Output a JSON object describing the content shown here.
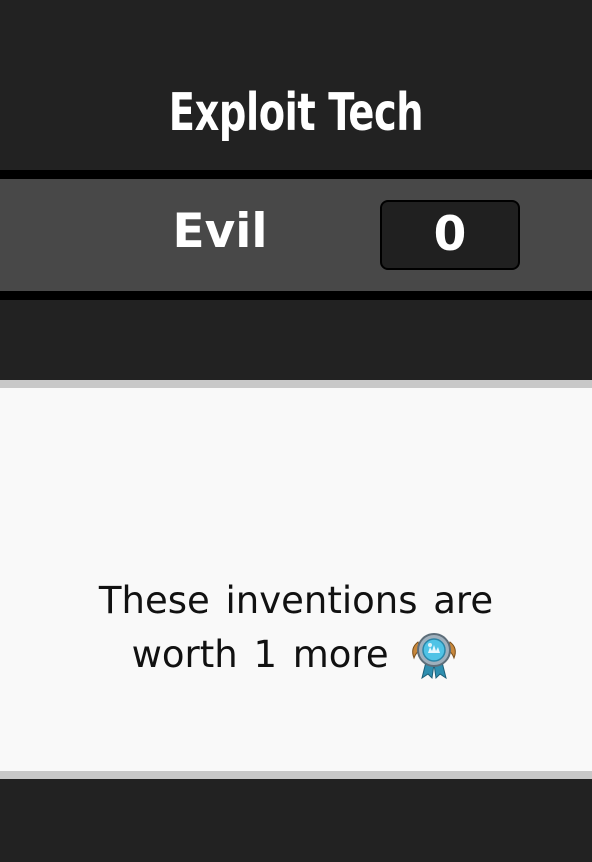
{
  "header": {
    "title": "Exploit Tech"
  },
  "score": {
    "label": "Evil",
    "value": "0"
  },
  "card": {
    "line1": "These inventions are",
    "line2": "worth 1 more",
    "icon": "medal-icon"
  }
}
